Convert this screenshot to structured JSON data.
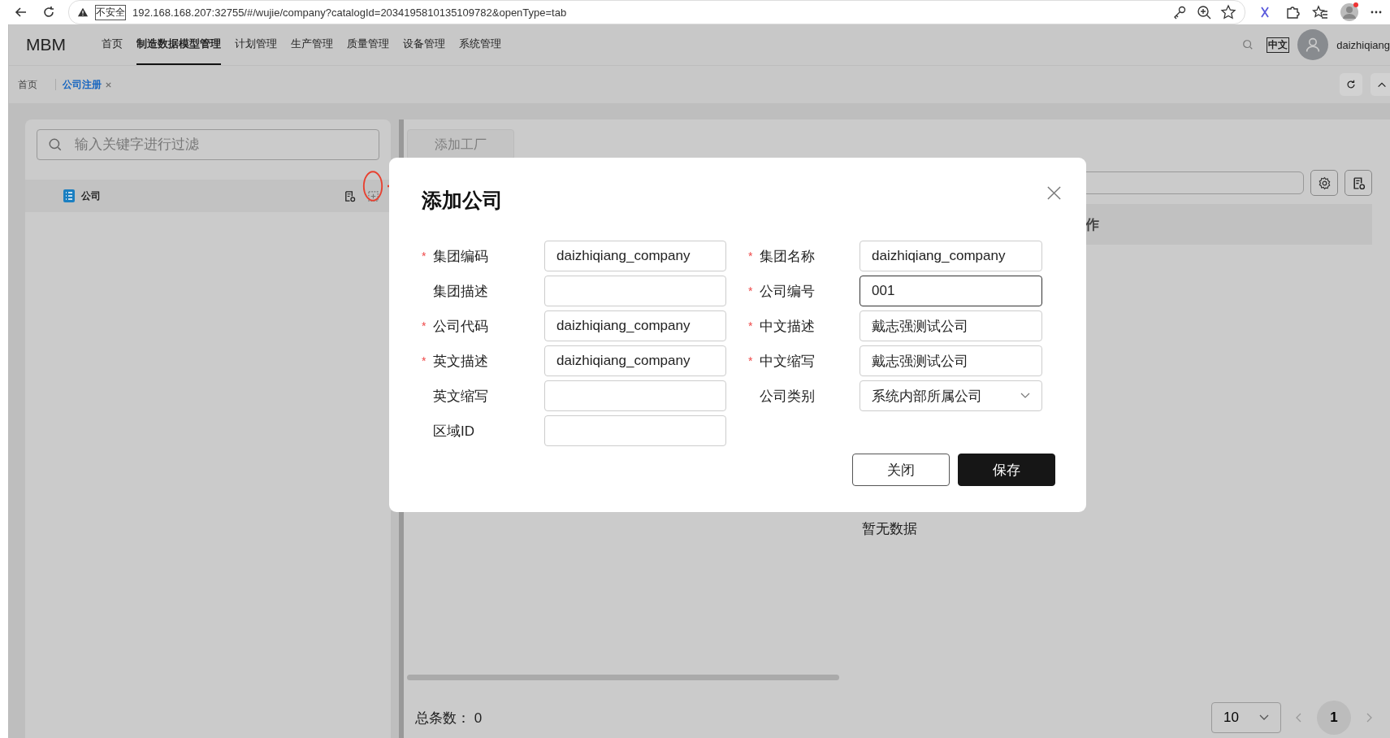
{
  "browser": {
    "security_label": "不安全",
    "url": "192.168.168.207:32755/#/wujie/company?catalogId=2034195810135109782&openType=tab"
  },
  "header": {
    "logo": "MBM",
    "nav": [
      {
        "label": "首页",
        "selected": false
      },
      {
        "label": "制造数据模型管理",
        "selected": true
      },
      {
        "label": "计划管理",
        "selected": false
      },
      {
        "label": "生产管理",
        "selected": false
      },
      {
        "label": "质量管理",
        "selected": false
      },
      {
        "label": "设备管理",
        "selected": false
      },
      {
        "label": "系统管理",
        "selected": false
      }
    ],
    "language": "中文",
    "username": "daizhiqiang"
  },
  "tabs": [
    {
      "label": "首页",
      "selected": false,
      "closable": false
    },
    {
      "label": "公司注册",
      "selected": true,
      "closable": true
    }
  ],
  "tree": {
    "search_placeholder": "输入关键字进行过滤",
    "items": [
      {
        "label": "公司"
      }
    ]
  },
  "main": {
    "add_button": "添加工厂",
    "table": {
      "columns": [
        "作"
      ]
    },
    "empty_text": "暂无数据",
    "total_label": "总条数：",
    "total": "0",
    "page_size": "10",
    "pages": [
      {
        "label": "1",
        "selected": true
      }
    ]
  },
  "dialog": {
    "title": "添加公司",
    "fields": [
      {
        "label": "集团编码",
        "required_mark": "*",
        "kind": "input",
        "value": "daizhiqiang_company",
        "focused": false
      },
      {
        "label": "集团名称",
        "required_mark": "*",
        "kind": "input",
        "value": "daizhiqiang_company",
        "focused": false
      },
      {
        "label": "集团描述",
        "kind": "input",
        "focused": false
      },
      {
        "label": "公司编号",
        "required_mark": "*",
        "kind": "input",
        "value": "001",
        "focused": true
      },
      {
        "label": "公司代码",
        "required_mark": "*",
        "kind": "input",
        "value": "daizhiqiang_company",
        "focused": false
      },
      {
        "label": "中文描述",
        "required_mark": "*",
        "kind": "input",
        "value": "戴志强测试公司",
        "focused": false
      },
      {
        "label": "英文描述",
        "required_mark": "*",
        "kind": "input",
        "value": "daizhiqiang_company",
        "focused": false
      },
      {
        "label": "中文缩写",
        "required_mark": "*",
        "kind": "input",
        "value": "戴志强测试公司",
        "focused": false
      },
      {
        "label": "英文缩写",
        "kind": "input",
        "focused": false
      },
      {
        "label": "公司类别",
        "kind": "select",
        "value": "系统内部所属公司",
        "focused": false
      },
      {
        "label": "区域ID",
        "kind": "input",
        "focused": false
      }
    ],
    "buttons": [
      {
        "label": "关闭",
        "kind": "secondary"
      },
      {
        "label": "保存",
        "kind": "primary"
      }
    ]
  }
}
